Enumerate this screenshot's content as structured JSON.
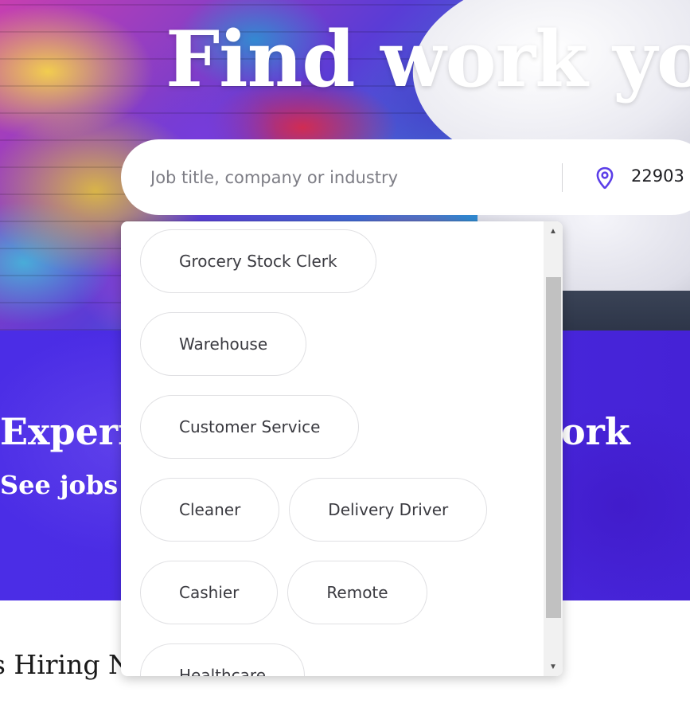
{
  "hero": {
    "title": "Find work you"
  },
  "search": {
    "placeholder": "Job title, company or industry",
    "location_value": "22903"
  },
  "band": {
    "title_left": "Experi",
    "title_right": "ork",
    "subtitle": "See jobs v"
  },
  "section": {
    "heading": "s Hiring No"
  },
  "suggestions": {
    "chips": [
      "Grocery Stock Clerk",
      "Warehouse",
      "Customer Service",
      "Cleaner",
      "Delivery Driver",
      "Cashier",
      "Remote",
      "Healthcare"
    ]
  },
  "colors": {
    "brand_purple": "#4b2de6",
    "pin_icon": "#5b3ee8"
  },
  "icons": {
    "location": "map-pin-icon",
    "scroll_up": "triangle-up-icon",
    "scroll_down": "triangle-down-icon"
  }
}
